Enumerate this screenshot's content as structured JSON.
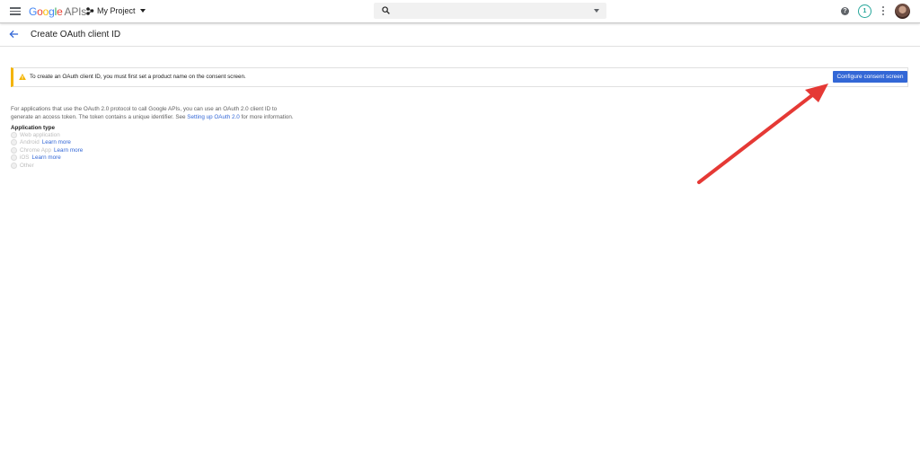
{
  "header": {
    "logo": {
      "letters": [
        "G",
        "o",
        "o",
        "g",
        "l",
        "e"
      ],
      "apis": "APIs"
    },
    "project_name": "My Project",
    "search_placeholder": "",
    "notification_count": "1",
    "help_glyph": "?"
  },
  "subheader": {
    "title": "Create OAuth client ID"
  },
  "banner": {
    "text": "To create an OAuth client ID, you must first set a product name on the consent screen.",
    "button_label": "Configure consent screen"
  },
  "description": {
    "line1": "For applications that use the OAuth 2.0 protocol to call Google APIs, you can use an OAuth 2.0 client ID to",
    "line2_prefix": "generate an access token. The token contains a unique identifier. See ",
    "link": "Setting up OAuth 2.0",
    "line2_suffix": " for more information."
  },
  "application_type": {
    "label": "Application type",
    "options": [
      {
        "label": "Web application",
        "link": ""
      },
      {
        "label": "Android",
        "link": "Learn more"
      },
      {
        "label": "Chrome App",
        "link": "Learn more"
      },
      {
        "label": "iOS",
        "link": "Learn more"
      },
      {
        "label": "Other",
        "link": ""
      }
    ]
  },
  "icons": {
    "menu": "menu-icon",
    "project": "project-icon",
    "search": "search-icon",
    "help": "help-icon",
    "more": "more-vert-icon",
    "back": "arrow-back-icon",
    "warning": "warning-icon"
  },
  "colors": {
    "primary": "#3367d6",
    "warning": "#f4b400",
    "annotation_arrow": "#e53935",
    "notification": "#26a69a"
  }
}
